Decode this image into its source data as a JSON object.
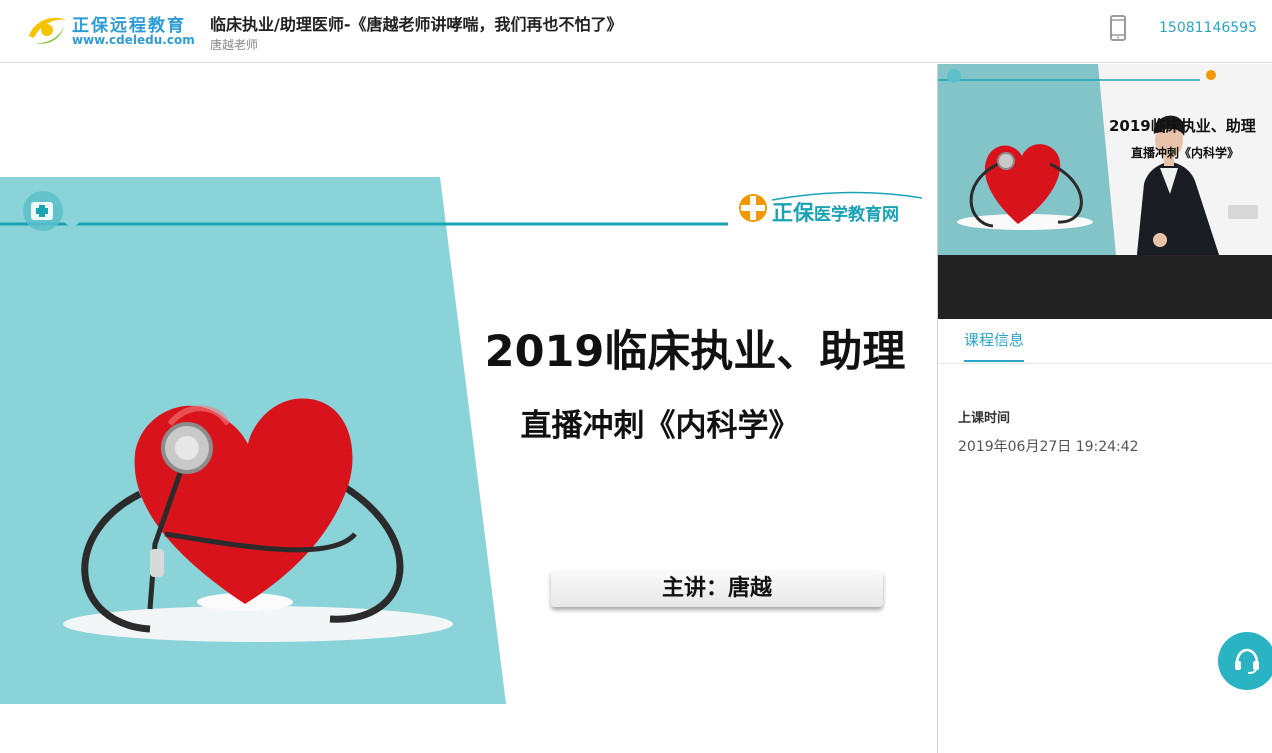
{
  "header": {
    "logo_cn": "正保远程教育",
    "logo_en": "www.cdeledu.com",
    "course_title": "临床执业/助理医师-《唐越老师讲哮喘，我们再也不怕了》",
    "teacher": "唐越老师",
    "phone_icon": "phone-icon",
    "phone_number": "15081146595"
  },
  "slide": {
    "brand_big": "正保",
    "brand_small": "医学教育网",
    "title": "2019临床执业、助理",
    "subtitle": "直播冲刺《内科学》",
    "presenter": "主讲：唐越",
    "accent_color": "#8ad3d9",
    "line_color": "#1aa3b5",
    "heart_color": "#d8131b"
  },
  "video": {
    "title": "2019临床执业、助理",
    "subtitle": "直播冲刺《内科学》"
  },
  "panel": {
    "tabs": [
      {
        "label": "课程信息"
      }
    ],
    "info_label": "上课时间",
    "info_value": "2019年06月27日 19:24:42"
  },
  "support": {
    "icon": "headset-icon"
  }
}
